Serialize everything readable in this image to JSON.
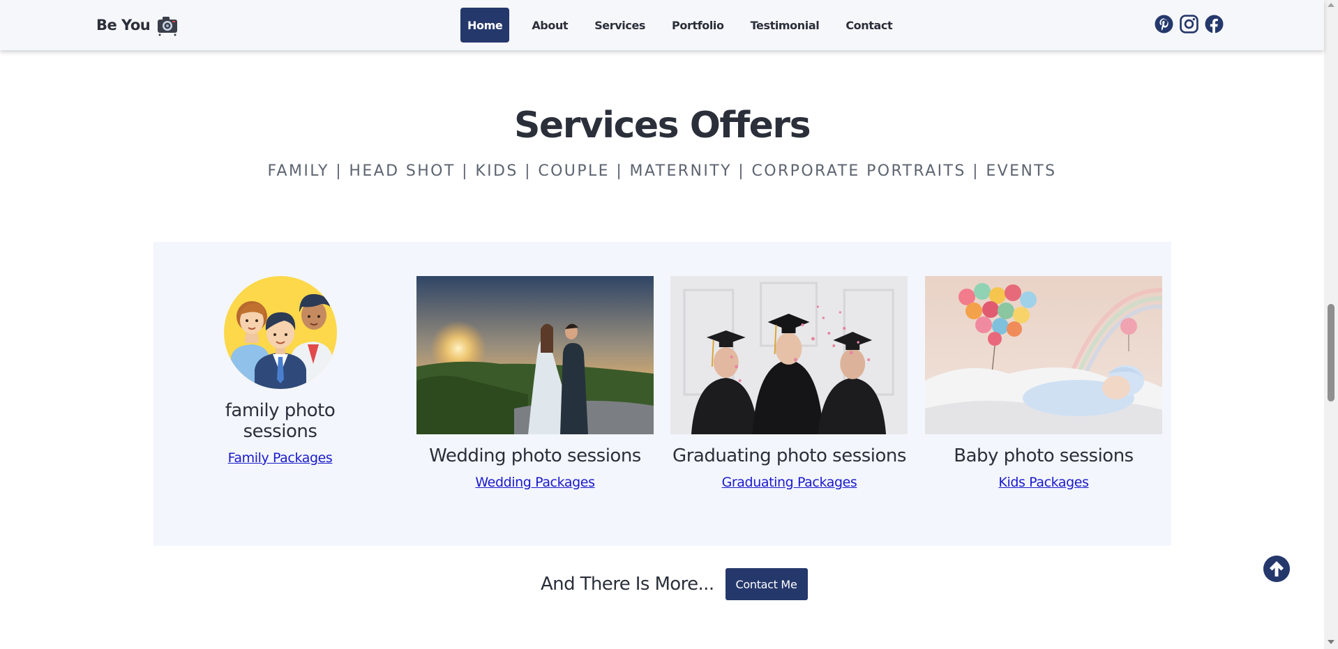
{
  "nav": {
    "brand": "Be You",
    "brand_icon": "camera-icon",
    "links": [
      "Home",
      "About",
      "Services",
      "Portfolio",
      "Testimonial",
      "Contact"
    ],
    "active": "Home",
    "social_icons": [
      "pinterest-icon",
      "instagram-icon",
      "facebook-icon"
    ]
  },
  "section": {
    "title": "Services Offers",
    "subtitle": "FAMILY | HEAD SHOT | KIDS | COUPLE | MATERNITY | CORPORATE PORTRAITS | EVENTS"
  },
  "cards": [
    {
      "title": "family photo sessions",
      "link": "Family Packages"
    },
    {
      "title": "Wedding photo sessions",
      "link": "Wedding Packages"
    },
    {
      "title": "Graduating photo sessions",
      "link": "Graduating Packages"
    },
    {
      "title": "Baby photo sessions",
      "link": "Kids Packages"
    }
  ],
  "more": {
    "text": "And There Is More...",
    "button": "Contact Me"
  },
  "colors": {
    "primary": "#25386c",
    "link": "#1a1acc",
    "panel": "#f3f6fc",
    "text": "#2b2f3a"
  },
  "scroll_to_top_icon": "arrow-up-circle-icon"
}
